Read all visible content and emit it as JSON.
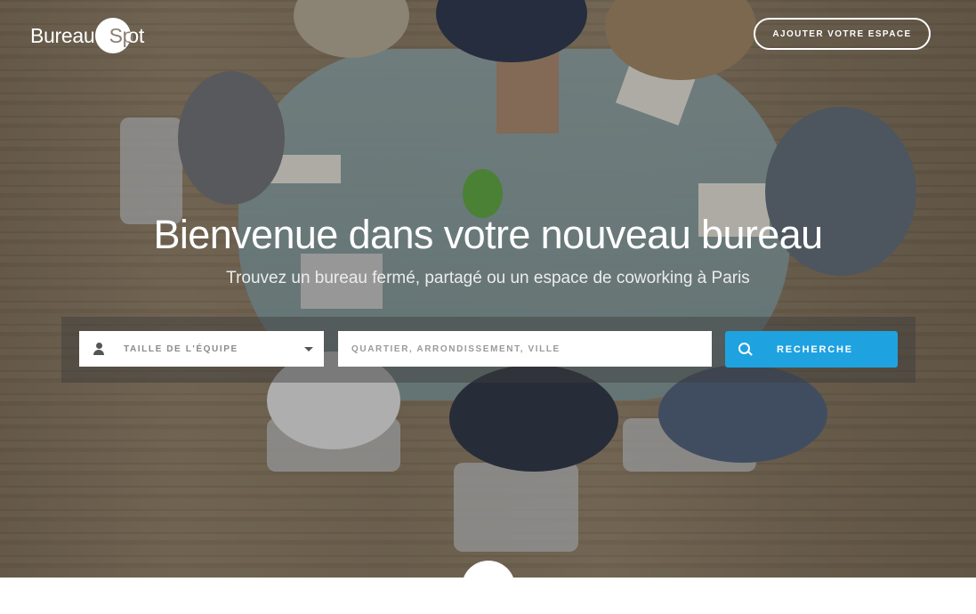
{
  "brand": {
    "name_part1": "Bureau",
    "name_part2": "Sp",
    "name_part3": "ot"
  },
  "header": {
    "add_space_label": "AJOUTER VOTRE ESPACE"
  },
  "hero": {
    "title": "Bienvenue dans votre nouveau bureau",
    "subtitle": "Trouvez un bureau fermé, partagé ou un espace de coworking à Paris"
  },
  "search": {
    "team_size_label": "TAILLE DE L'ÉQUIPE",
    "team_icon": "person-icon",
    "location_placeholder": "QUARTIER, ARRONDISSEMENT, VILLE",
    "location_value": "",
    "button_label": "RECHERCHE",
    "button_icon": "search-icon"
  },
  "colors": {
    "accent": "#1fa2e0",
    "text_light": "#ffffff"
  }
}
